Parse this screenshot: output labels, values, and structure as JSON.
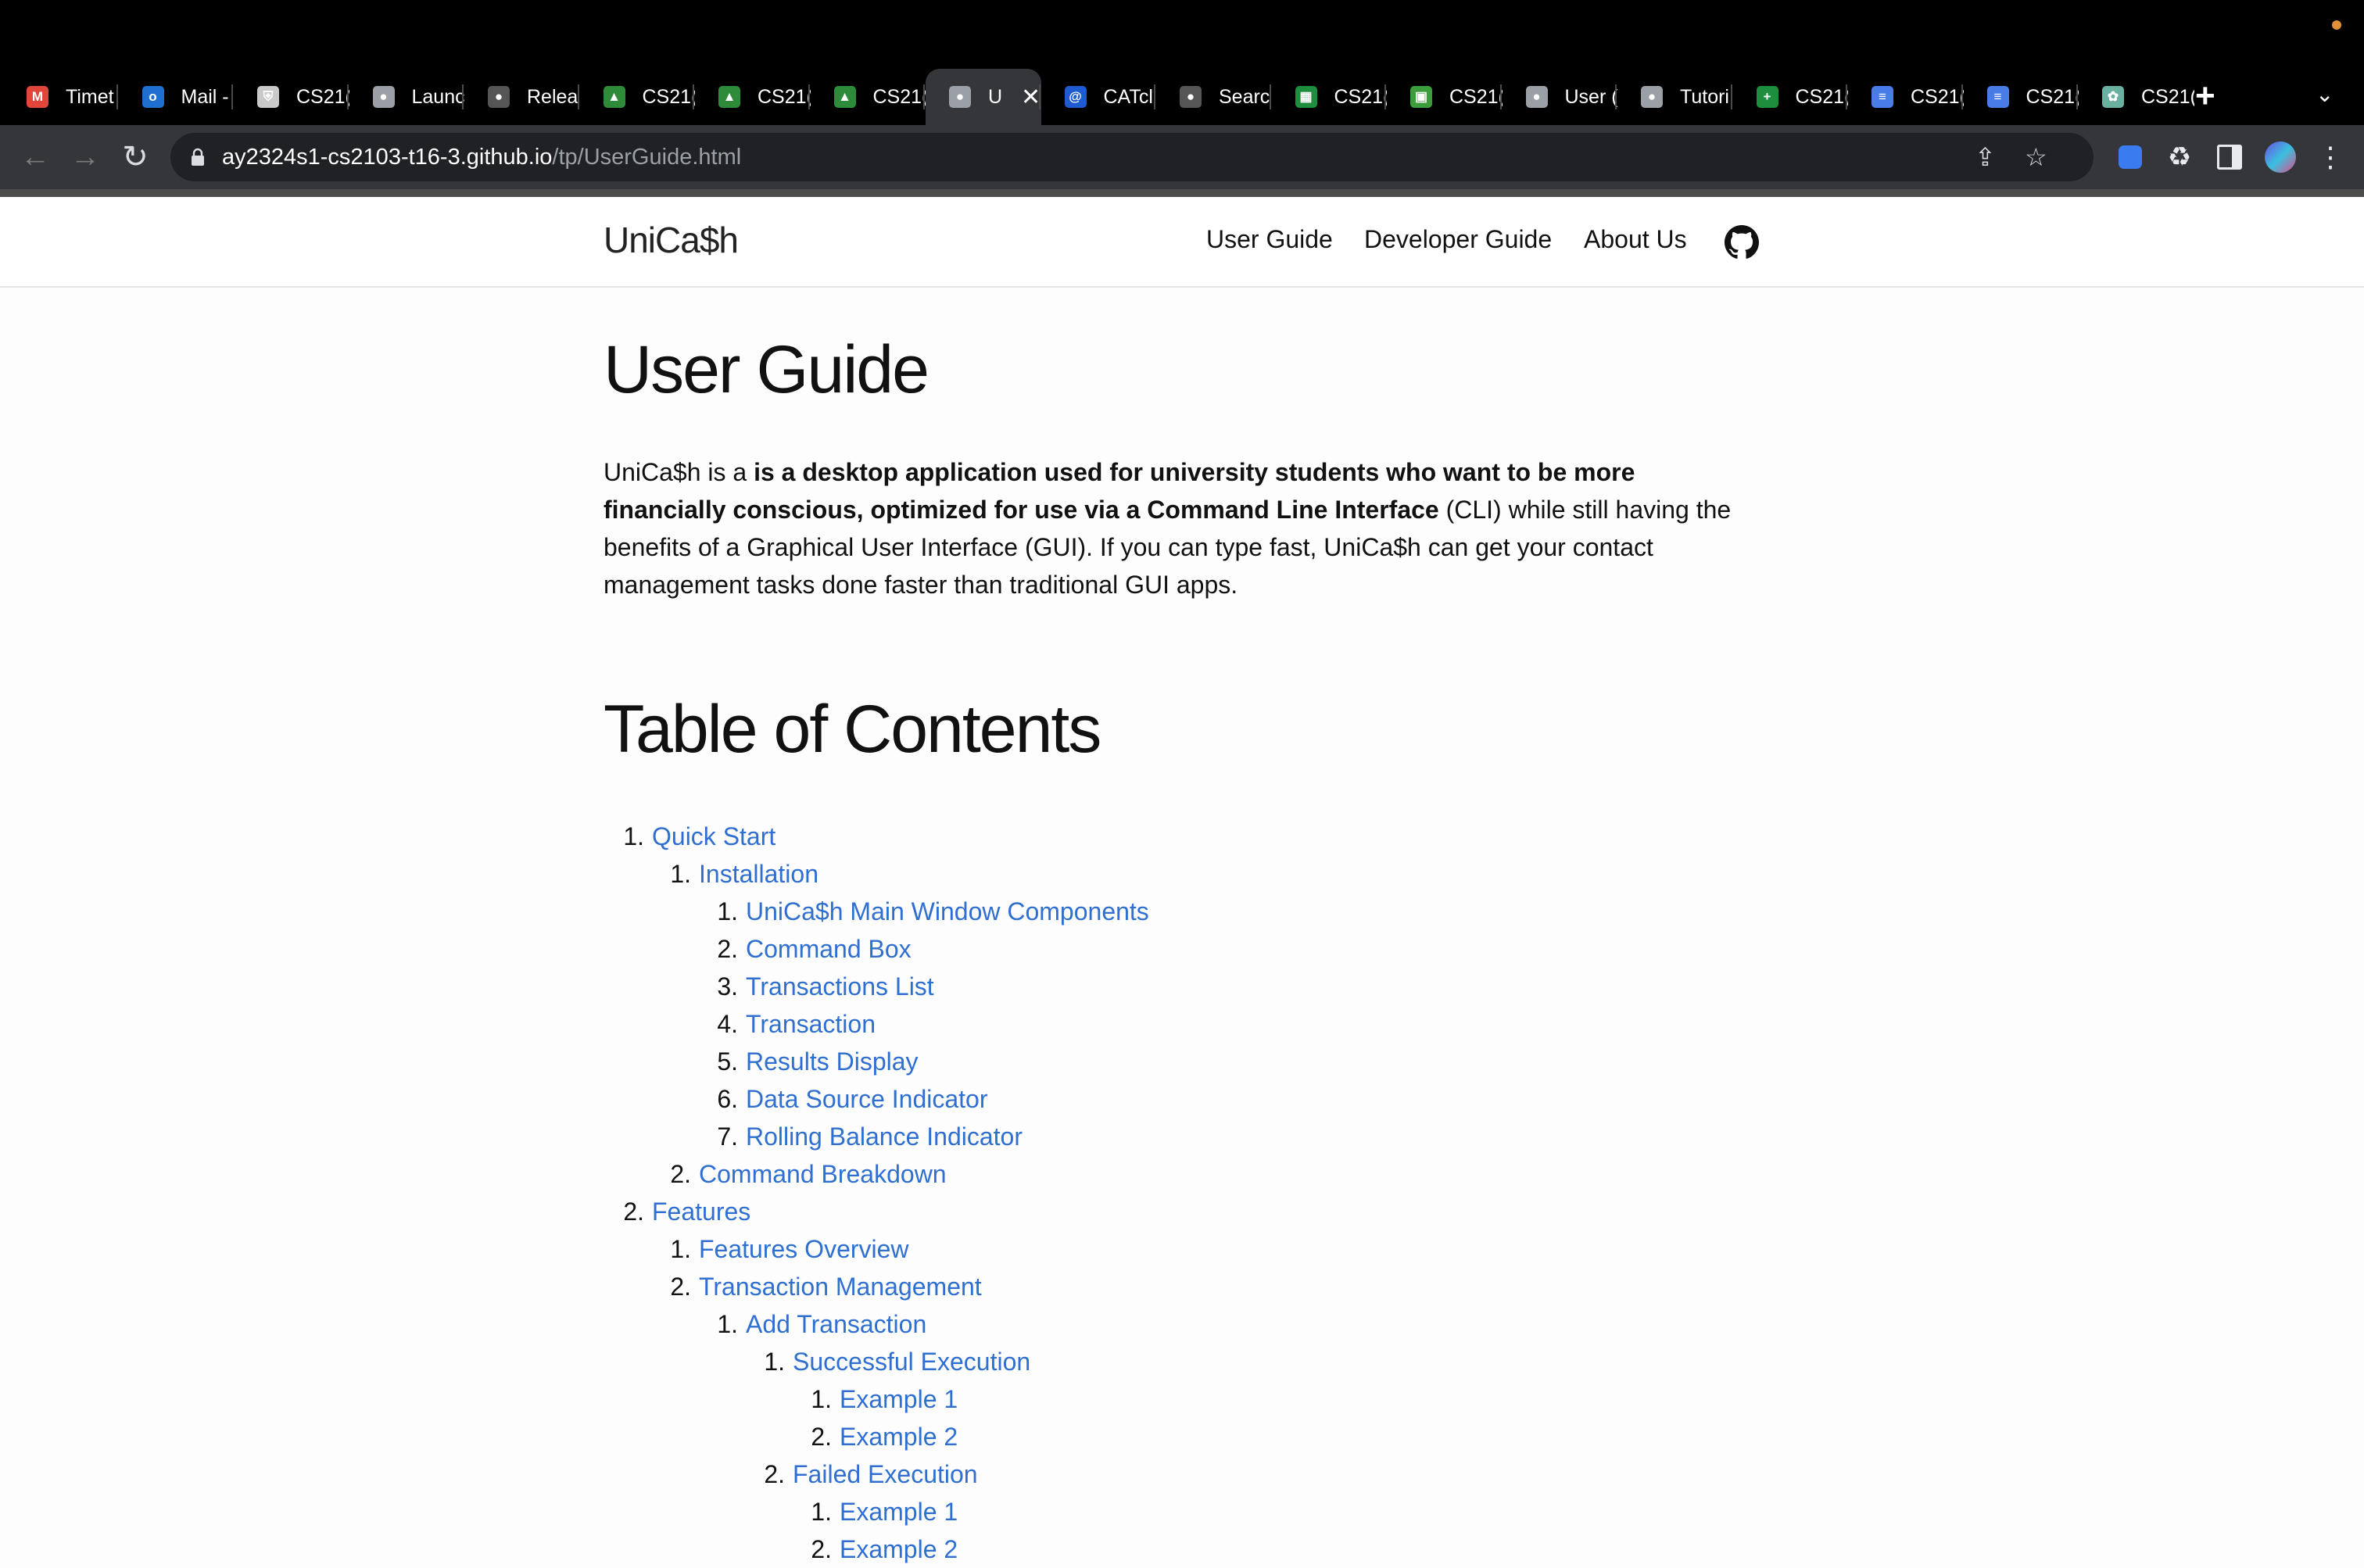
{
  "browser": {
    "tabs": [
      {
        "label": "Timet",
        "icon": "m-logo-icon",
        "color": "#e0463a"
      },
      {
        "label": "Mail -",
        "icon": "outlook-icon",
        "color": "#1e6fd0"
      },
      {
        "label": "CS21(",
        "icon": "crest-icon",
        "color": "#c9c9c9"
      },
      {
        "label": "Launc",
        "icon": "globe-icon",
        "color": "#9aa0a6"
      },
      {
        "label": "Relea",
        "icon": "github-icon",
        "color": "#555555"
      },
      {
        "label": "CS21(",
        "icon": "graduation-cap-icon",
        "color": "#2e8b3a"
      },
      {
        "label": "CS21(",
        "icon": "graduation-cap-icon",
        "color": "#2e8b3a"
      },
      {
        "label": "CS21(",
        "icon": "graduation-cap-icon",
        "color": "#2e8b3a"
      },
      {
        "label": "U",
        "icon": "globe-icon",
        "color": "#9aa0a6",
        "active": true
      },
      {
        "label": "CATcl",
        "icon": "catcher-icon",
        "color": "#1e5ad0"
      },
      {
        "label": "Searc",
        "icon": "github-icon",
        "color": "#555555"
      },
      {
        "label": "CS21(",
        "icon": "sheets-icon",
        "color": "#1e8e3e"
      },
      {
        "label": "CS21(",
        "icon": "grid-icon",
        "color": "#3c9d3c"
      },
      {
        "label": "User (",
        "icon": "globe-icon",
        "color": "#9aa0a6"
      },
      {
        "label": "Tutori",
        "icon": "globe-icon",
        "color": "#9aa0a6"
      },
      {
        "label": "CS21(",
        "icon": "plus-doc-icon",
        "color": "#1e8e3e"
      },
      {
        "label": "CS21(",
        "icon": "docs-icon",
        "color": "#4a7ce8"
      },
      {
        "label": "CS21(",
        "icon": "docs-icon",
        "color": "#4a7ce8"
      },
      {
        "label": "CS21(",
        "icon": "openai-icon",
        "color": "#6ab0a0"
      }
    ],
    "url_host": "ay2324s1-cs2103-t16-3.github.io",
    "url_path": "/tp/UserGuide.html"
  },
  "site": {
    "title": "UniCa$h",
    "nav": [
      "User Guide",
      "Developer Guide",
      "About Us"
    ]
  },
  "content": {
    "title": "User Guide",
    "intro": {
      "lead": "UniCa$h is a ",
      "bold1": "is a desktop application used for university students who want to be more financially conscious, optimized for use via a Command Line Interface",
      "tail": " (CLI) while still having the benefits of a Graphical User Interface (GUI). If you can type fast, UniCa$h can get your contact management tasks done faster than traditional GUI apps."
    },
    "toc_heading": "Table of Contents",
    "toc": [
      {
        "num": "1.",
        "label": "Quick Start",
        "level": 0
      },
      {
        "num": "1.",
        "label": "Installation",
        "level": 1
      },
      {
        "num": "1.",
        "label": "UniCa$h Main Window Components",
        "level": 2
      },
      {
        "num": "2.",
        "label": "Command Box",
        "level": 2
      },
      {
        "num": "3.",
        "label": "Transactions List",
        "level": 2
      },
      {
        "num": "4.",
        "label": "Transaction",
        "level": 2
      },
      {
        "num": "5.",
        "label": "Results Display",
        "level": 2
      },
      {
        "num": "6.",
        "label": "Data Source Indicator",
        "level": 2
      },
      {
        "num": "7.",
        "label": "Rolling Balance Indicator",
        "level": 2
      },
      {
        "num": "2.",
        "label": "Command Breakdown",
        "level": 1
      },
      {
        "num": "2.",
        "label": "Features",
        "level": 0
      },
      {
        "num": "1.",
        "label": "Features Overview",
        "level": 1
      },
      {
        "num": "2.",
        "label": "Transaction Management",
        "level": 1
      },
      {
        "num": "1.",
        "label": "Add Transaction",
        "level": 2
      },
      {
        "num": "1.",
        "label": "Successful Execution",
        "level": 3
      },
      {
        "num": "1.",
        "label": "Example 1",
        "level": 4
      },
      {
        "num": "2.",
        "label": "Example 2",
        "level": 4
      },
      {
        "num": "2.",
        "label": "Failed Execution",
        "level": 3
      },
      {
        "num": "1.",
        "label": "Example 1",
        "level": 4
      },
      {
        "num": "2.",
        "label": "Example 2",
        "level": 4
      }
    ]
  }
}
